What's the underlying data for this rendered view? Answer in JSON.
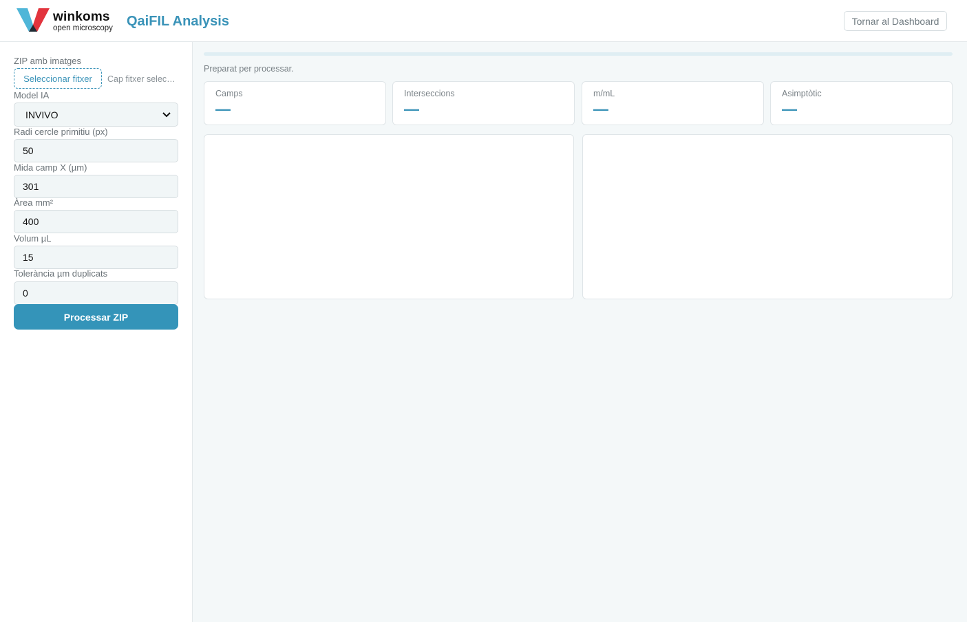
{
  "header": {
    "brand_name": "winkoms",
    "brand_sub": "open microscopy",
    "app_title": "QaiFIL Analysis",
    "dashboard_button": "Tornar al Dashboard"
  },
  "sidebar": {
    "zip_label": "ZIP amb imatges",
    "file_button": "Seleccionar fitxer",
    "file_status": "Cap fitxer seleccionat",
    "model_label": "Model IA",
    "model_value": "INVIVO",
    "fields": [
      {
        "label": "Radi cercle primitiu (px)",
        "value": "50"
      },
      {
        "label": "Mida camp X (µm)",
        "value": "301"
      },
      {
        "label": "Àrea mm²",
        "value": "400"
      },
      {
        "label": "Volum µL",
        "value": "15"
      },
      {
        "label": "Tolerància µm duplicats",
        "value": "0"
      }
    ],
    "process_button": "Processar ZIP"
  },
  "main": {
    "progress_fraction": 0,
    "status": "Preparat per processar.",
    "stats": [
      {
        "label": "Camps",
        "value": "—"
      },
      {
        "label": "Interseccions",
        "value": "—"
      },
      {
        "label": "m/mL",
        "value": "—"
      },
      {
        "label": "Asimptòtic",
        "value": "—"
      }
    ]
  },
  "colors": {
    "accent": "#3a93b8",
    "button": "#3494b9",
    "logo_blue": "#4fb6d8",
    "logo_red": "#e2343d"
  }
}
